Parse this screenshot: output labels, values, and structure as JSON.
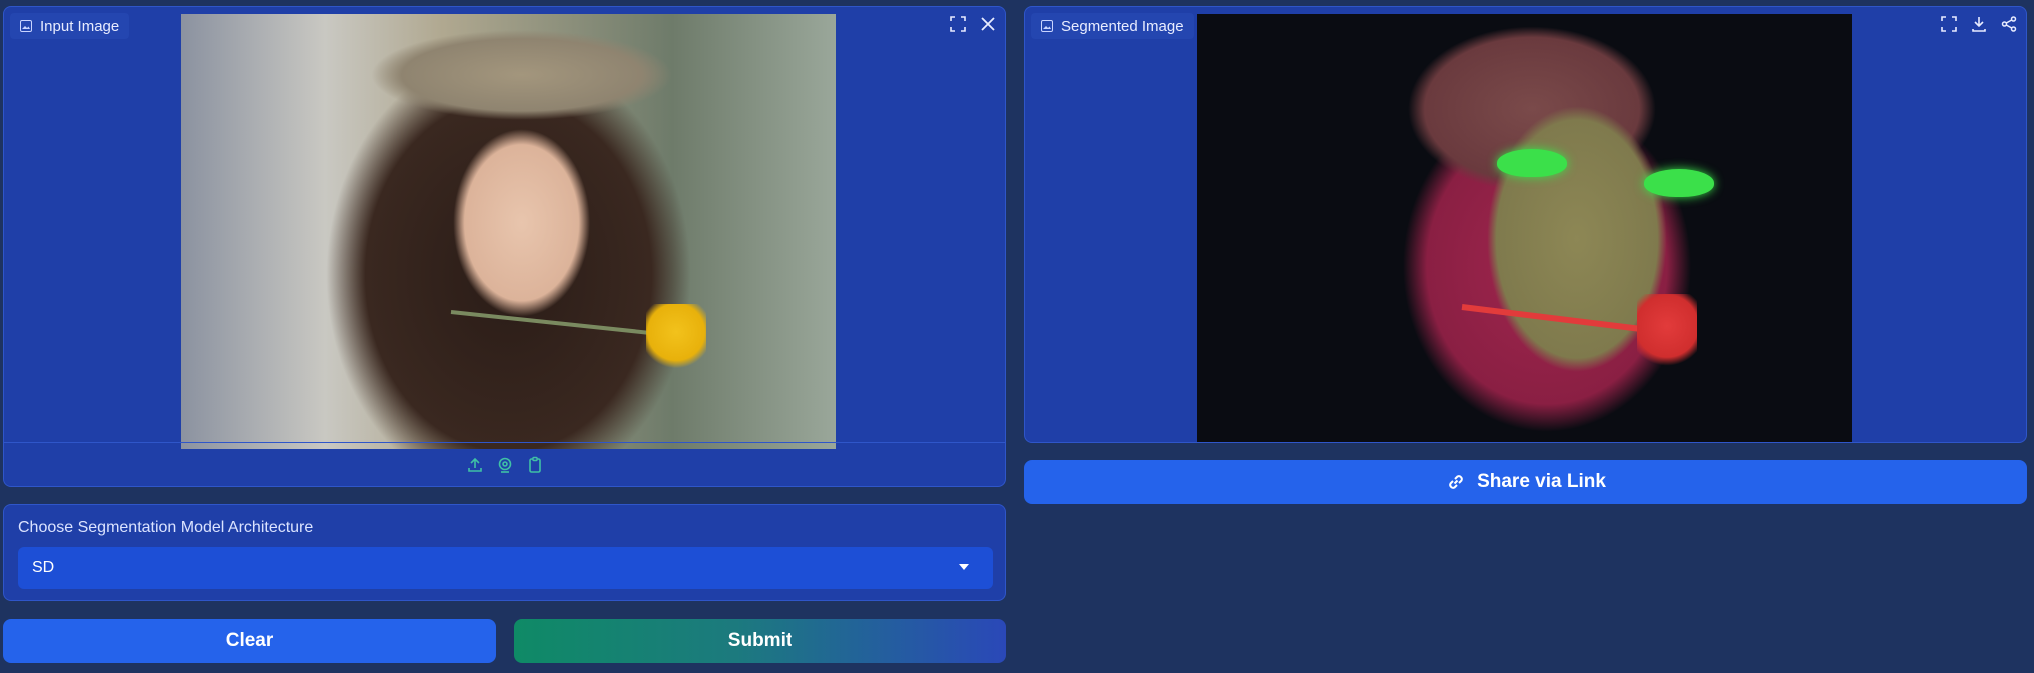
{
  "input_panel": {
    "label": "Input Image",
    "icons": [
      "expand-icon",
      "close-icon"
    ],
    "upload_icons": [
      "upload-icon",
      "webcam-icon",
      "clipboard-icon"
    ]
  },
  "output_panel": {
    "label": "Segmented Image",
    "icons": [
      "expand-icon",
      "download-icon",
      "share-icon"
    ]
  },
  "share": {
    "label": "Share via Link",
    "icon": "link-icon"
  },
  "model_select": {
    "label": "Choose Segmentation Model Architecture",
    "value": "SD"
  },
  "actions": {
    "clear_label": "Clear",
    "submit_label": "Submit"
  },
  "colors": {
    "background": "#1e3360",
    "panel": "#1f3fa8",
    "primary_button": "#2563eb",
    "submit_gradient_start": "#0f8a66",
    "submit_gradient_end": "#2a48b8",
    "icon_accent": "#3fc1a5"
  }
}
